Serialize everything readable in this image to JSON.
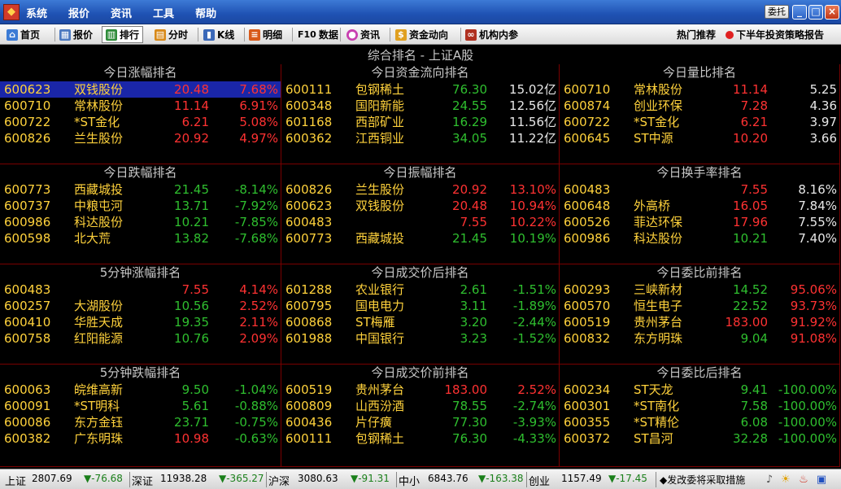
{
  "titlebar": {
    "menu": [
      "系统",
      "报价",
      "资讯",
      "工具",
      "帮助"
    ],
    "weituo_label": "委托"
  },
  "toolbar": {
    "home": "首页",
    "quote": "报价",
    "rank": "排行",
    "timeshare": "分时",
    "kline": "K线",
    "detail": "明细",
    "f10": "F10",
    "data": "数据",
    "news": "资讯",
    "fund_flow": "资金动向",
    "institution": "机构内参",
    "hot_recommend": "热门推荐",
    "promo": "下半年投资策略报告"
  },
  "main_title": "综合排名 - 上证A股",
  "panels": {
    "p1": {
      "title": "今日涨幅排名",
      "rows": [
        {
          "code": "600623",
          "name": "双钱股份",
          "price": "20.48",
          "val": "7.68%"
        },
        {
          "code": "600710",
          "name": "常林股份",
          "price": "11.14",
          "val": "6.91%"
        },
        {
          "code": "600722",
          "name": "*ST金化",
          "price": "6.21",
          "val": "5.08%"
        },
        {
          "code": "600826",
          "name": "兰生股份",
          "price": "20.92",
          "val": "4.97%"
        }
      ]
    },
    "p2": {
      "title": "今日资金流向排名",
      "rows": [
        {
          "code": "600111",
          "name": "包钢稀土",
          "price": "76.30",
          "val": "15.02亿"
        },
        {
          "code": "600348",
          "name": "国阳新能",
          "price": "24.55",
          "val": "12.56亿"
        },
        {
          "code": "601168",
          "name": "西部矿业",
          "price": "16.29",
          "val": "11.56亿"
        },
        {
          "code": "600362",
          "name": "江西铜业",
          "price": "34.05",
          "val": "11.22亿"
        }
      ]
    },
    "p3": {
      "title": "今日量比排名",
      "rows": [
        {
          "code": "600710",
          "name": "常林股份",
          "price": "11.14",
          "val": "5.25"
        },
        {
          "code": "600874",
          "name": "创业环保",
          "price": "7.28",
          "val": "4.36"
        },
        {
          "code": "600722",
          "name": "*ST金化",
          "price": "6.21",
          "val": "3.97"
        },
        {
          "code": "600645",
          "name": "ST中源",
          "price": "10.20",
          "val": "3.66"
        }
      ]
    },
    "p4": {
      "title": "今日跌幅排名",
      "rows": [
        {
          "code": "600773",
          "name": "西藏城投",
          "price": "21.45",
          "val": "-8.14%"
        },
        {
          "code": "600737",
          "name": "中粮屯河",
          "price": "13.71",
          "val": "-7.92%"
        },
        {
          "code": "600986",
          "name": "科达股份",
          "price": "10.21",
          "val": "-7.85%"
        },
        {
          "code": "600598",
          "name": "北大荒",
          "price": "13.82",
          "val": "-7.68%"
        }
      ]
    },
    "p5": {
      "title": "今日振幅排名",
      "rows": [
        {
          "code": "600826",
          "name": "兰生股份",
          "price": "20.92",
          "val": "13.10%"
        },
        {
          "code": "600623",
          "name": "双钱股份",
          "price": "20.48",
          "val": "10.94%"
        },
        {
          "code": "600483",
          "name": "",
          "price": "7.55",
          "val": "10.22%"
        },
        {
          "code": "600773",
          "name": "西藏城投",
          "price": "21.45",
          "val": "10.19%"
        }
      ]
    },
    "p6": {
      "title": "今日换手率排名",
      "rows": [
        {
          "code": "600483",
          "name": "",
          "price": "7.55",
          "val": "8.16%"
        },
        {
          "code": "600648",
          "name": "外高桥",
          "price": "16.05",
          "val": "7.84%"
        },
        {
          "code": "600526",
          "name": "菲达环保",
          "price": "17.96",
          "val": "7.55%"
        },
        {
          "code": "600986",
          "name": "科达股份",
          "price": "10.21",
          "val": "7.40%"
        }
      ]
    },
    "p7": {
      "title": "5分钟涨幅排名",
      "rows": [
        {
          "code": "600483",
          "name": "",
          "price": "7.55",
          "val": "4.14%"
        },
        {
          "code": "600257",
          "name": "大湖股份",
          "price": "10.56",
          "val": "2.52%"
        },
        {
          "code": "600410",
          "name": "华胜天成",
          "price": "19.35",
          "val": "2.11%"
        },
        {
          "code": "600758",
          "name": "红阳能源",
          "price": "10.76",
          "val": "2.09%"
        }
      ]
    },
    "p8": {
      "title": "今日成交价后排名",
      "rows": [
        {
          "code": "601288",
          "name": "农业银行",
          "price": "2.61",
          "val": "-1.51%"
        },
        {
          "code": "600795",
          "name": "国电电力",
          "price": "3.11",
          "val": "-1.89%"
        },
        {
          "code": "600868",
          "name": "ST梅雁",
          "price": "3.20",
          "val": "-2.44%"
        },
        {
          "code": "601988",
          "name": "中国银行",
          "price": "3.23",
          "val": "-1.52%"
        }
      ]
    },
    "p9": {
      "title": "今日委比前排名",
      "rows": [
        {
          "code": "600293",
          "name": "三峡新材",
          "price": "14.52",
          "val": "95.06%"
        },
        {
          "code": "600570",
          "name": "恒生电子",
          "price": "22.52",
          "val": "93.73%"
        },
        {
          "code": "600519",
          "name": "贵州茅台",
          "price": "183.00",
          "val": "91.92%"
        },
        {
          "code": "600832",
          "name": "东方明珠",
          "price": "9.04",
          "val": "91.08%"
        }
      ]
    },
    "p10": {
      "title": "5分钟跌幅排名",
      "rows": [
        {
          "code": "600063",
          "name": "皖维高新",
          "price": "9.50",
          "val": "-1.04%"
        },
        {
          "code": "600091",
          "name": "*ST明科",
          "price": "5.61",
          "val": "-0.88%"
        },
        {
          "code": "600086",
          "name": "东方金钰",
          "price": "23.71",
          "val": "-0.75%"
        },
        {
          "code": "600382",
          "name": "广东明珠",
          "price": "10.98",
          "val": "-0.63%"
        }
      ]
    },
    "p11": {
      "title": "今日成交价前排名",
      "rows": [
        {
          "code": "600519",
          "name": "贵州茅台",
          "price": "183.00",
          "val": "2.52%"
        },
        {
          "code": "600809",
          "name": "山西汾酒",
          "price": "78.55",
          "val": "-2.74%"
        },
        {
          "code": "600436",
          "name": "片仔癀",
          "price": "77.30",
          "val": "-3.93%"
        },
        {
          "code": "600111",
          "name": "包钢稀土",
          "price": "76.30",
          "val": "-4.33%"
        }
      ]
    },
    "p12": {
      "title": "今日委比后排名",
      "rows": [
        {
          "code": "600234",
          "name": "ST天龙",
          "price": "9.41",
          "val": "-100.00%"
        },
        {
          "code": "600301",
          "name": "*ST南化",
          "price": "7.58",
          "val": "-100.00%"
        },
        {
          "code": "600355",
          "name": "*ST精伦",
          "price": "6.08",
          "val": "-100.00%"
        },
        {
          "code": "600372",
          "name": "ST昌河",
          "price": "32.28",
          "val": "-100.00%"
        }
      ]
    }
  },
  "statusbar": {
    "sh_label": "上证",
    "sh_value": "2807.69",
    "sh_change": "▼-76.68",
    "sz_label": "深证",
    "sz_value": "11938.28",
    "sz_change": "▼-365.27",
    "hs_label": "沪深",
    "hs_value": "3080.63",
    "hs_change": "▼-91.31",
    "zx_label": "中小",
    "zx_value": "6843.76",
    "zx_change": "▼-163.38",
    "cy_label": "创业",
    "cy_value": "1157.49",
    "cy_change": "▼-17.45",
    "ticker": "◆发改委将采取措施"
  }
}
